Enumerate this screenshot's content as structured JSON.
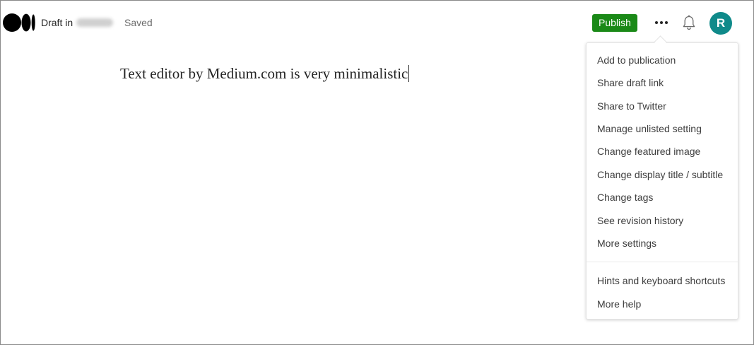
{
  "header": {
    "draft_label": "Draft in",
    "saved_label": "Saved",
    "publish_label": "Publish",
    "avatar_initial": "R"
  },
  "editor": {
    "text": "Text editor by Medium.com is very minimalistic"
  },
  "menu": {
    "items": [
      "Add to publication",
      "Share draft link",
      "Share to Twitter",
      "Manage unlisted setting",
      "Change featured image",
      "Change display title / subtitle",
      "Change tags",
      "See revision history",
      "More settings"
    ],
    "help_items": [
      "Hints and keyboard shortcuts",
      "More help"
    ]
  },
  "colors": {
    "publish_green": "#1a8917",
    "avatar_teal": "#0f8a8a"
  }
}
